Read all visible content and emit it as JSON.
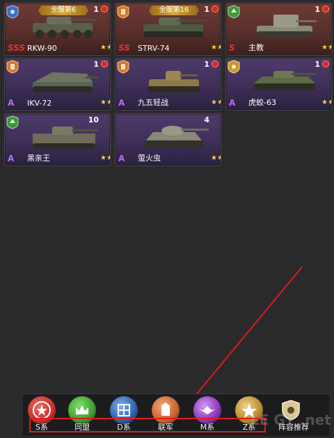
{
  "cards": [
    {
      "rank": "全服第6",
      "count": "1",
      "grade": "SSS",
      "name": "RKW-90",
      "stars": "★★★★★",
      "tier": "red",
      "icon": "tank-class-icon-blue"
    },
    {
      "rank": "全服第16",
      "count": "1",
      "grade": "SS",
      "name": "STRV-74",
      "stars": "★★★★★",
      "tier": "red",
      "icon": "tank-class-icon-orange"
    },
    {
      "rank": "",
      "count": "1",
      "grade": "S",
      "name": "主教",
      "stars": "★★★★★",
      "tier": "red",
      "icon": "tank-class-icon-green"
    },
    {
      "rank": "",
      "count": "1",
      "grade": "A",
      "name": "IKV-72",
      "stars": "★★★★",
      "tier": "purple",
      "icon": "tank-class-icon-orange"
    },
    {
      "rank": "",
      "count": "1",
      "grade": "A",
      "name": "九五轻战",
      "stars": "★★★★",
      "tier": "purple",
      "icon": "tank-class-icon-orange"
    },
    {
      "rank": "",
      "count": "1",
      "grade": "A",
      "name": "虎蛟-63",
      "stars": "★★★★",
      "tier": "purple",
      "icon": "tank-class-icon-gold"
    },
    {
      "rank": "",
      "count": "10",
      "grade": "A",
      "name": "黑亲王",
      "stars": "★★★★",
      "tier": "purple",
      "icon": "tank-class-icon-green"
    },
    {
      "rank": "",
      "count": "4",
      "grade": "A",
      "name": "萤火虫",
      "stars": "★★★★",
      "tier": "purple",
      "icon": ""
    }
  ],
  "categories": [
    {
      "label": "S系",
      "color": "#c6302b"
    },
    {
      "label": "同盟",
      "color": "#3f9c2e"
    },
    {
      "label": "D系",
      "color": "#2e5fa8"
    },
    {
      "label": "联军",
      "color": "#c8622a"
    },
    {
      "label": "M系",
      "color": "#8a35b8"
    },
    {
      "label": "Z系",
      "color": "#b88a2a"
    }
  ],
  "recommend_label": "阵容推荐",
  "watermark": "LE GY .net"
}
